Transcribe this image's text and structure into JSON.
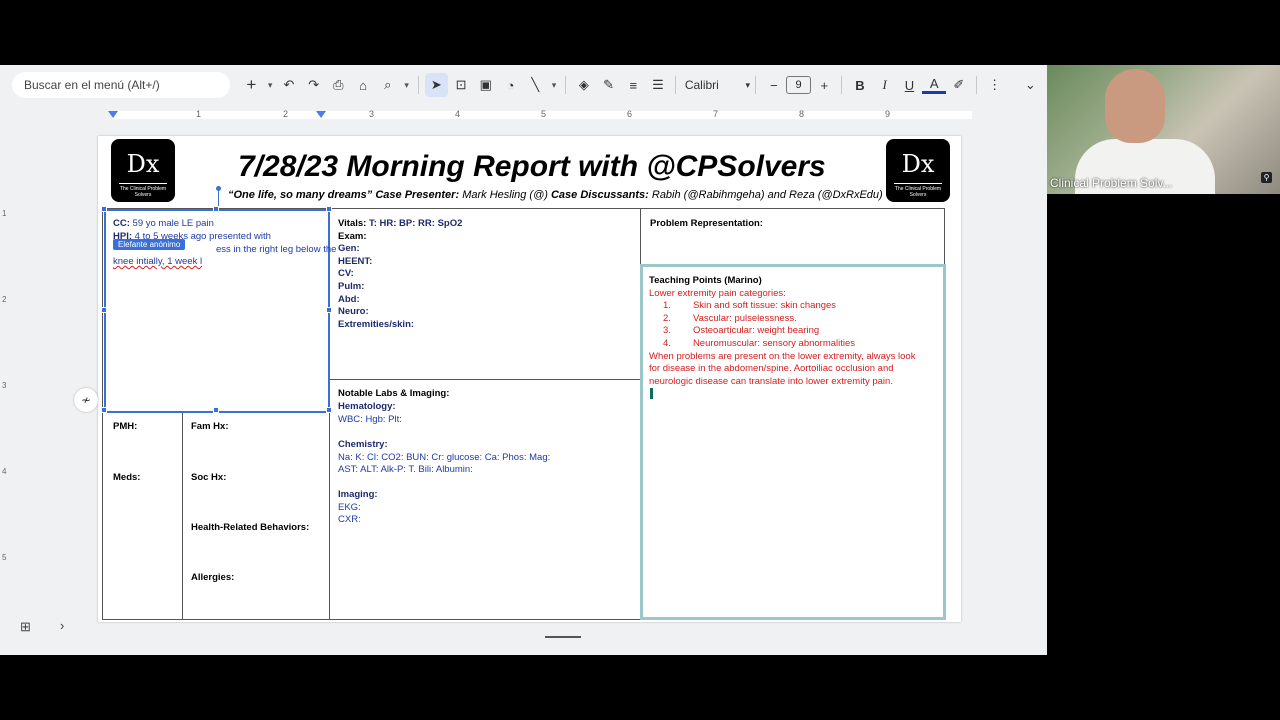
{
  "toolbar": {
    "search_placeholder": "Buscar en el menú (Alt+/)",
    "font_name": "Calibri",
    "font_size": "9"
  },
  "ruler": {
    "numbers": [
      "1",
      "2",
      "3",
      "4",
      "5",
      "6",
      "7",
      "8",
      "9"
    ]
  },
  "vruler": {
    "numbers": [
      "1",
      "2",
      "3",
      "4",
      "5"
    ]
  },
  "slide": {
    "logo_text": "Dx",
    "logo_sub": "The Clinical Problem Solvers",
    "title": "7/28/23 Morning Report with @CPSolvers",
    "subtitle_quote": "“One life, so many dreams”",
    "subtitle_presenter_label": "Case Presenter:",
    "subtitle_presenter": "Mark Hesling (@)",
    "subtitle_discussants_label": "Case Discussants:",
    "subtitle_discussants": "Rabih (@Rabihmgeha) and Reza (@DxRxEdu)",
    "cc_label": "CC:",
    "cc_value": "59 yo male LE pain",
    "hpi_label": "HPI:",
    "hpi_line1": "4 to 5 weeks ago presented with",
    "hpi_line2": "ess in the right leg below the",
    "hpi_line3": "knee intially, 1 week l",
    "anon_tag": "Elefante anónimo",
    "vitals_label": "Vitals:",
    "vitals_value": "T: HR: BP: RR: SpO2",
    "exam": [
      "Exam:",
      "Gen:",
      "HEENT:",
      "CV:",
      "Pulm:",
      "Abd:",
      "Neuro:",
      "Extremities/skin:"
    ],
    "problem_rep": "Problem Representation:",
    "teaching_title": "Teaching Points (Marino)",
    "teaching_intro": "Lower extremity pain categories:",
    "teaching_items": [
      {
        "num": "1.",
        "text": "Skin and soft tissue: skin changes"
      },
      {
        "num": "2.",
        "text": "Vascular: pulselessness."
      },
      {
        "num": "3.",
        "text": "Osteoarticular: weight bearing"
      },
      {
        "num": "4.",
        "text": "Neuromuscular: sensory abnormalities"
      }
    ],
    "teaching_para": [
      "When problems are present on the lower extremity, always look",
      "for disease in the abdomen/spine. Aortoiliac occlusion and",
      "neurologic disease can translate into lower extremity pain."
    ],
    "pmh": "PMH:",
    "meds": "Meds:",
    "fam_hx": "Fam Hx:",
    "soc_hx": "Soc Hx:",
    "health_behaviors": "Health-Related Behaviors:",
    "allergies": "Allergies:",
    "labs_title": "Notable Labs & Imaging:",
    "hematology_label": "Hematology:",
    "hematology_value": "WBC: Hgb: Plt:",
    "chemistry_label": "Chemistry:",
    "chem_line1": "Na:  K:  Cl:  CO2: BUN: Cr: glucose: Ca: Phos: Mag:",
    "chem_line2": "AST: ALT: Alk-P: T. Bili:  Albumin:",
    "imaging_label": "Imaging:",
    "ekg": "EKG:",
    "cxr": "CXR:"
  },
  "video": {
    "participant_name": "Clinical Problem Solv..."
  },
  "colors": {
    "label_blue": "#1f2a6d",
    "text_blue": "#1f3aa8",
    "teaching_red": "#d42020",
    "selection": "#3a6ed8",
    "teaching_border": "#9cc7c9"
  }
}
